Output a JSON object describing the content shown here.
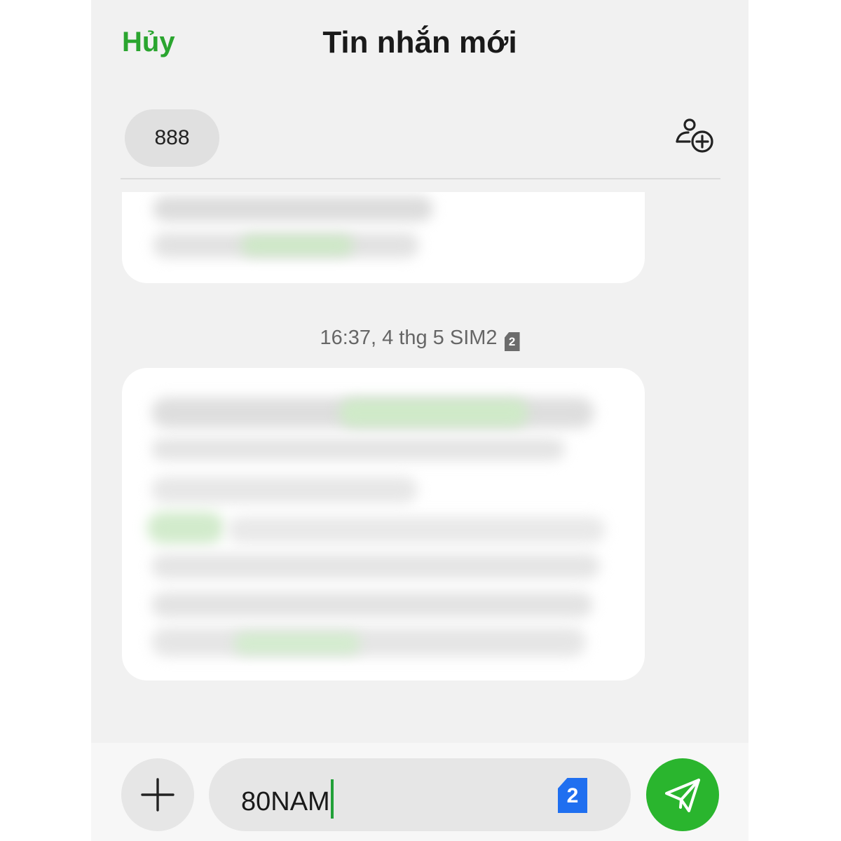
{
  "header": {
    "cancel_label": "Hủy",
    "title": "Tin nhắn mới"
  },
  "recipient": {
    "chip_label": "888",
    "add_contact_icon": "add-contact-icon"
  },
  "thread": {
    "timestamp": "16:37, 4 thg 5 SIM2",
    "timestamp_sim_badge": "2",
    "messages_blurred": true
  },
  "composer": {
    "attach_icon": "plus-icon",
    "input_value": "80NAM",
    "sim_selector": "2",
    "send_icon": "send-icon"
  },
  "colors": {
    "accent_green": "#2aa52f",
    "send_green": "#2ab52e",
    "sim_blue": "#1f6ff0",
    "background": "#f1f1f1"
  }
}
